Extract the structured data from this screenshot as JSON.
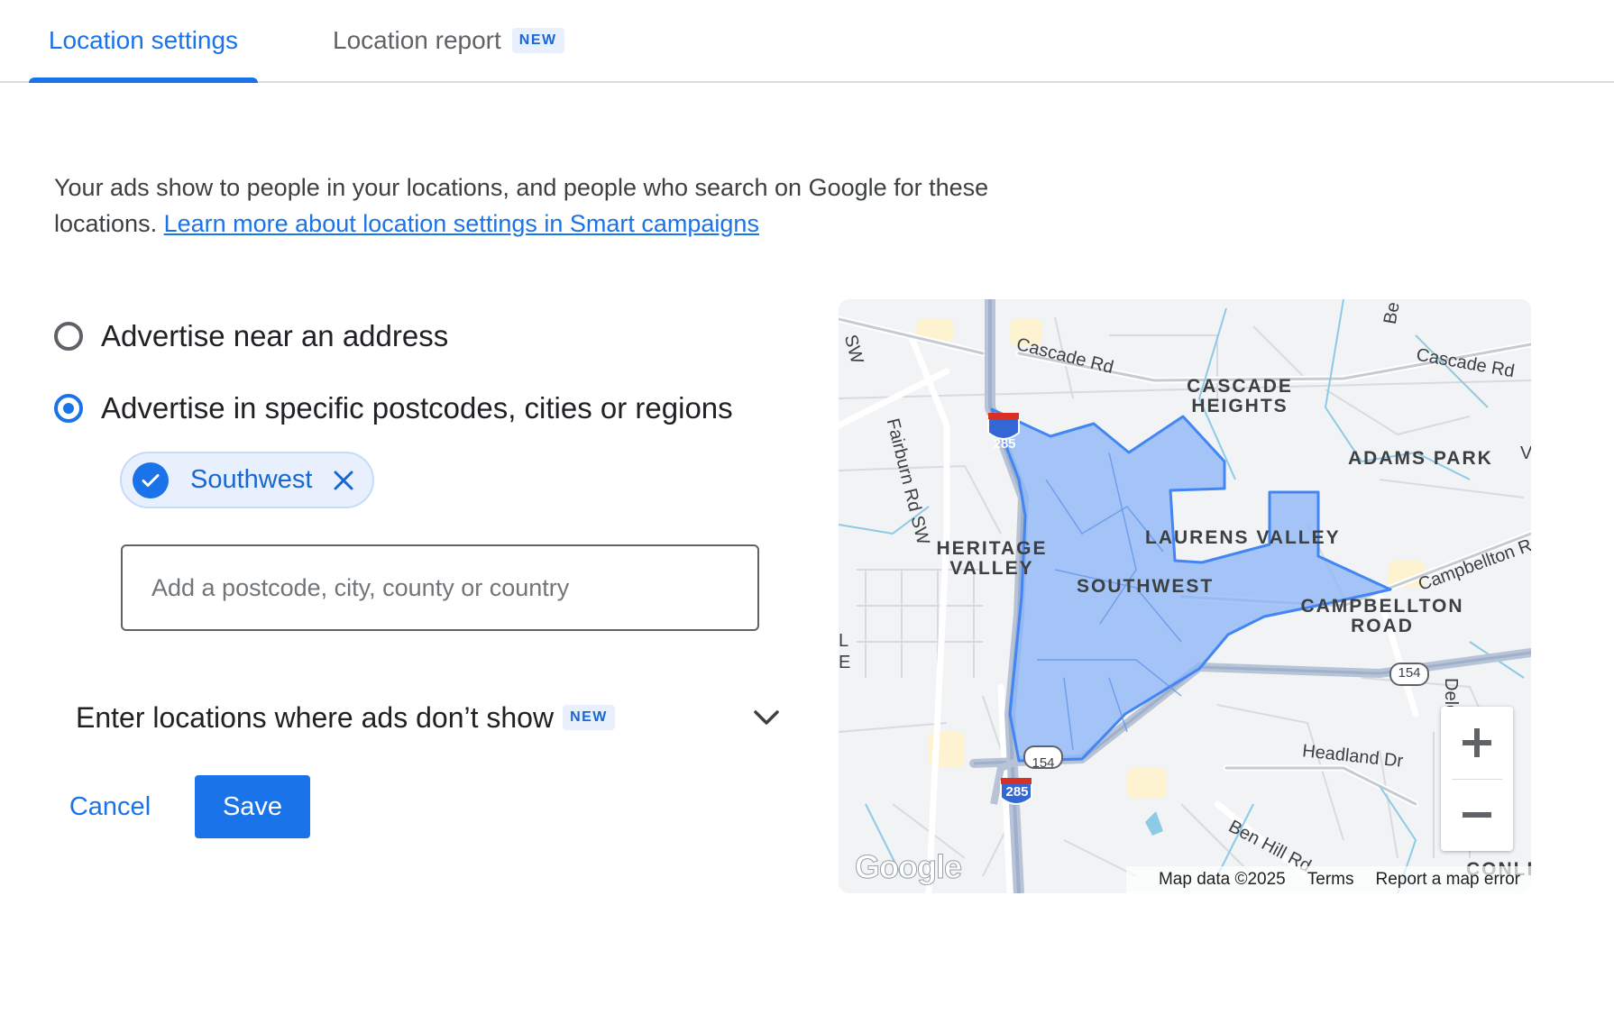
{
  "tabs": {
    "settings": "Location settings",
    "report": "Location report",
    "report_badge": "NEW"
  },
  "description": {
    "text": "Your ads show to people in your locations, and people who search on Google for these locations.",
    "link": "Learn more about location settings in Smart campaigns"
  },
  "options": {
    "near_address": "Advertise near an address",
    "specific_regions": "Advertise in specific postcodes, cities or regions",
    "selected": "specific_regions"
  },
  "chip": {
    "label": "Southwest",
    "icon": "check-icon",
    "close_icon": "close-icon"
  },
  "location_input": {
    "value": "",
    "placeholder": "Add a postcode, city, county or country"
  },
  "exclude": {
    "label": "Enter locations where ads don’t show",
    "badge": "NEW",
    "icon": "chevron-down-icon"
  },
  "actions": {
    "cancel": "Cancel",
    "save": "Save"
  },
  "map": {
    "roads": {
      "cascade_rd_1": "Cascade Rd",
      "cascade_rd_2": "Cascade Rd",
      "fairburn": "Fairburn Rd SW",
      "campbellton": "Campbellton R",
      "headland": "Headland Dr",
      "ben_hill": "Ben Hill Rd",
      "sw": "SW",
      "be": "Be",
      "delo": "Delo",
      "v": "V",
      "l": "L",
      "e": "E"
    },
    "shields": {
      "i285_top": "285",
      "i285_bottom": "285",
      "r154_a": "154",
      "r154_b": "154"
    },
    "neighborhoods": {
      "cascade_heights": "CASCADE HEIGHTS",
      "adams_park": "ADAMS PARK",
      "heritage_valley": "HERITAGE VALLEY",
      "laurens_valley": "LAURENS VALLEY",
      "southwest": "SOUTHWEST",
      "campbellton_road": "CAMPBELLTON ROAD",
      "conle": "CONLE"
    },
    "logo": "Google",
    "attribution": {
      "data": "Map data ©2025",
      "terms": "Terms",
      "report": "Report a map error"
    },
    "zoom_in_icon": "plus-icon",
    "zoom_out_icon": "minus-icon",
    "region_fill": "#8ab4f8",
    "region_stroke": "#4285f4"
  }
}
